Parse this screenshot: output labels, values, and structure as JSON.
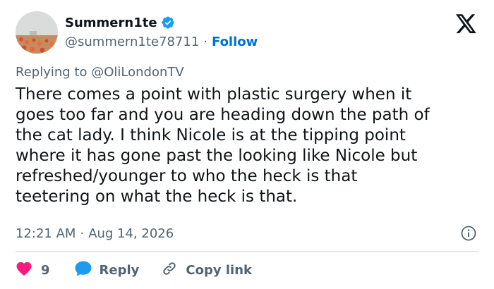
{
  "author": {
    "display_name": "Summern1te",
    "handle": "@summern1te78711",
    "separator": "·",
    "follow_label": "Follow",
    "verified": true,
    "avatar": "flower-field-avatar"
  },
  "brand": {
    "logo": "x-logo-icon"
  },
  "reply": {
    "prefix": "Replying to",
    "mention": "@OliLondonTV"
  },
  "tweet": {
    "text": "There comes a point with plastic surgery when it\ngoes too far and you are heading down the path of\nthe cat lady. I think Nicole is at the tipping point\nwhere it has gone past the looking like Nicole but\nrefreshed/younger to who the heck is that\nteetering on what the heck is that."
  },
  "meta": {
    "time": "12:21 AM",
    "separator": "·",
    "date": "Aug 14, 2026",
    "info_icon": "info-icon"
  },
  "actions": {
    "like_count": "9",
    "reply_label": "Reply",
    "copy_label": "Copy link"
  },
  "colors": {
    "link_blue": "#006fd6",
    "like_red": "#f91880",
    "verified_blue": "#1d9bf0",
    "reply_blue": "#1d9bf0",
    "muted_text": "#536471",
    "text": "#0f1419"
  }
}
